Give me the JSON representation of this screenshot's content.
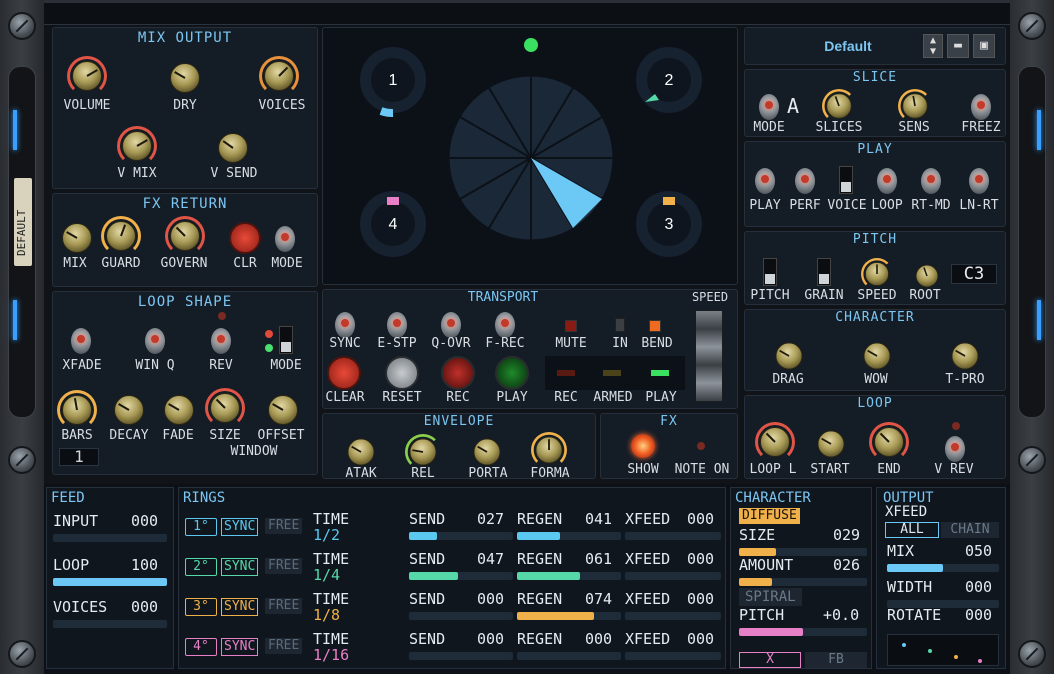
{
  "preset": {
    "name": "Default",
    "side_label": "DEFAULT"
  },
  "mix_output": {
    "title": "MIX OUTPUT",
    "knobs": [
      "VOLUME",
      "DRY",
      "VOICES",
      "V MIX",
      "V SEND"
    ]
  },
  "fx_return": {
    "title": "FX RETURN",
    "knobs": [
      "MIX",
      "GUARD",
      "GOVERN",
      "CLR",
      "MODE"
    ]
  },
  "loop_shape": {
    "title": "LOOP SHAPE",
    "switches": [
      "XFADE",
      "WIN Q",
      "REV",
      "MODE"
    ],
    "knobs": [
      "BARS",
      "DECAY",
      "FADE",
      "SIZE",
      "OFFSET"
    ],
    "window_label": "WINDOW",
    "bars_value": "1"
  },
  "display": {
    "rings": [
      "1",
      "2",
      "3",
      "4"
    ]
  },
  "transport": {
    "title": "TRANSPORT",
    "speed_label": "SPEED",
    "row1": [
      "SYNC",
      "E-STP",
      "Q-OVR",
      "F-REC",
      "MUTE",
      "IN",
      "BEND"
    ],
    "row2": [
      "CLEAR",
      "RESET",
      "REC",
      "PLAY",
      "REC",
      "ARMED",
      "PLAY"
    ]
  },
  "envelope": {
    "title": "ENVELOPE",
    "knobs": [
      "ATAK",
      "REL",
      "PORTA",
      "FORMA"
    ]
  },
  "fx": {
    "title": "FX",
    "items": [
      "SHOW",
      "NOTE ON"
    ]
  },
  "slice": {
    "title": "SLICE",
    "labels": [
      "MODE",
      "SLICES",
      "SENS",
      "FREEZ"
    ],
    "mode_value": "A"
  },
  "play": {
    "title": "PLAY",
    "labels": [
      "PLAY",
      "PERF",
      "VOICE",
      "LOOP",
      "RT-MD",
      "LN-RT"
    ]
  },
  "pitch": {
    "title": "PITCH",
    "labels": [
      "PITCH",
      "GRAIN",
      "SPEED",
      "ROOT"
    ],
    "root_value": "C3"
  },
  "character": {
    "title": "CHARACTER",
    "labels": [
      "DRAG",
      "WOW",
      "T-PRO"
    ]
  },
  "loop": {
    "title": "LOOP",
    "labels": [
      "LOOP L",
      "START",
      "END",
      "V REV"
    ]
  },
  "feed": {
    "title": "FEED",
    "rows": [
      {
        "label": "INPUT",
        "value": "000",
        "fill": 0
      },
      {
        "label": "LOOP",
        "value": "100",
        "fill": 1.0
      },
      {
        "label": "VOICES",
        "value": "000",
        "fill": 0
      }
    ]
  },
  "rings": {
    "title": "RINGS",
    "sync": "SYNC",
    "free": "FREE",
    "time_label": "TIME",
    "send_label": "SEND",
    "regen_label": "REGEN",
    "xfeed_label": "XFEED",
    "rows": [
      {
        "num": "1",
        "time": "1/2",
        "send": "027",
        "regen": "041",
        "xfeed": "000",
        "send_fill": 0.27,
        "regen_fill": 0.41,
        "color": "#5bc8f0"
      },
      {
        "num": "2",
        "time": "1/4",
        "send": "047",
        "regen": "061",
        "xfeed": "000",
        "send_fill": 0.47,
        "regen_fill": 0.61,
        "color": "#56d8a8"
      },
      {
        "num": "3",
        "time": "1/8",
        "send": "000",
        "regen": "074",
        "xfeed": "000",
        "send_fill": 0,
        "regen_fill": 0.74,
        "color": "#f0b04a"
      },
      {
        "num": "4",
        "time": "1/16",
        "send": "000",
        "regen": "000",
        "xfeed": "000",
        "send_fill": 0,
        "regen_fill": 0,
        "color": "#e880c8"
      }
    ]
  },
  "character_b": {
    "title": "CHARACTER",
    "diffuse": "DIFFUSE",
    "size_label": "SIZE",
    "size": "029",
    "size_fill": 0.29,
    "amount_label": "AMOUNT",
    "amount": "026",
    "amount_fill": 0.26,
    "spiral": "SPIRAL",
    "pitch_label": "PITCH",
    "pitch": "+0.0",
    "pitch_fill": 0.5,
    "x": "X",
    "fb": "FB"
  },
  "output": {
    "title": "OUTPUT",
    "xfeed": "XFEED",
    "all": "ALL",
    "chain": "CHAIN",
    "mix_label": "MIX",
    "mix": "050",
    "mix_fill": 0.5,
    "width_label": "WIDTH",
    "width": "000",
    "rotate_label": "ROTATE",
    "rotate": "000"
  },
  "colors": {
    "accent": "#7cc6f2",
    "knob_arc": "#e05545",
    "wedge": "#6cc8f5"
  }
}
